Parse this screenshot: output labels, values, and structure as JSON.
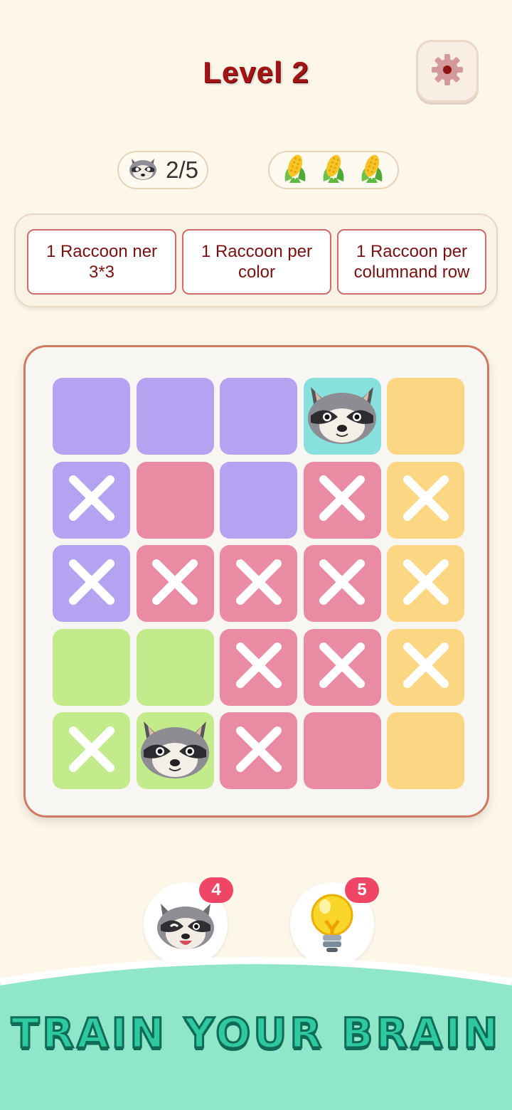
{
  "header": {
    "title": "Level 2"
  },
  "stats": {
    "progress": "2/5",
    "lives": 3
  },
  "rules": [
    "1 Raccoon ner 3*3",
    "1 Raccoon per color",
    "1 Raccoon per columnand row"
  ],
  "colors": {
    "purple": "#b3a3f0",
    "pink": "#e88ba3",
    "yellow": "#fbd784",
    "green": "#c3ea8b",
    "teal": "#87e0db"
  },
  "board": {
    "rows": [
      [
        "purple:empty",
        "purple:empty",
        "purple:empty",
        "teal:raccoon",
        "yellow:empty"
      ],
      [
        "purple:x",
        "pink:empty",
        "purple:empty",
        "pink:x",
        "yellow:x"
      ],
      [
        "purple:x",
        "pink:x",
        "pink:x",
        "pink:x",
        "yellow:x"
      ],
      [
        "green:empty",
        "green:empty",
        "pink:x",
        "pink:x",
        "yellow:x"
      ],
      [
        "green:x",
        "green:raccoon",
        "pink:x",
        "pink:empty",
        "yellow:empty"
      ]
    ]
  },
  "powerups": {
    "raccoon_hint_count": "4",
    "lightbulb_hint_count": "5"
  },
  "footer": {
    "tagline": "TRAIN YOUR BRAIN"
  }
}
